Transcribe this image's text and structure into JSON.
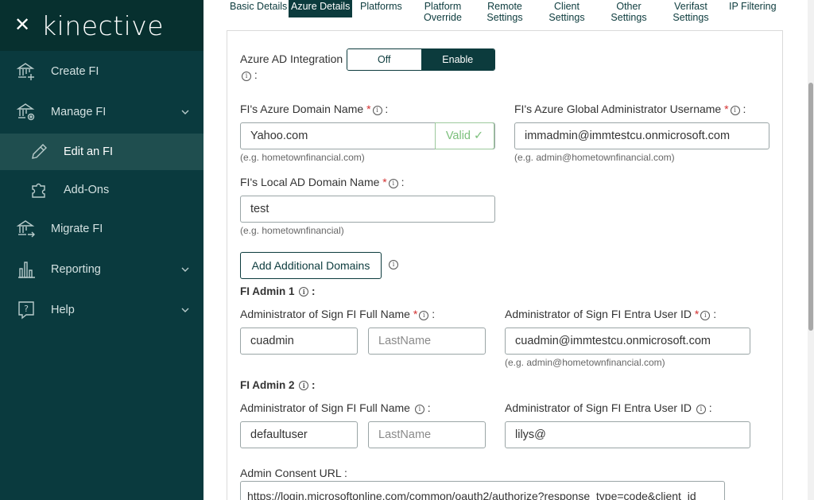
{
  "sidebar": {
    "brand": "kinective",
    "items": [
      {
        "label": "Create FI"
      },
      {
        "label": "Manage FI"
      },
      {
        "label": "Edit an FI"
      },
      {
        "label": "Add-Ons"
      },
      {
        "label": "Migrate FI"
      },
      {
        "label": "Reporting"
      },
      {
        "label": "Help"
      }
    ]
  },
  "tabs": [
    {
      "line1": "Basic Details",
      "line2": ""
    },
    {
      "line1": "Azure Details",
      "line2": ""
    },
    {
      "line1": "Platforms",
      "line2": ""
    },
    {
      "line1": "Platform",
      "line2": "Override"
    },
    {
      "line1": "Remote",
      "line2": "Settings"
    },
    {
      "line1": "Client",
      "line2": "Settings"
    },
    {
      "line1": "Other",
      "line2": "Settings"
    },
    {
      "line1": "Verifast",
      "line2": "Settings"
    },
    {
      "line1": "IP Filtering",
      "line2": ""
    }
  ],
  "azure": {
    "integration_label": "Azure AD Integration",
    "toggle_off": "Off",
    "toggle_on": "Enable",
    "domain_label": "FI's Azure Domain Name",
    "domain_value": "Yahoo.com",
    "domain_valid": "Valid ✓",
    "domain_hint": "(e.g. hometownfinancial.com)",
    "admin_label": "FI's Azure Global Administrator Username",
    "admin_value": "immadmin@immtestcu.onmicrosoft.com",
    "admin_hint": "(e.g. admin@hometownfinancial.com)",
    "local_label": "FI's Local AD Domain Name",
    "local_value": "test",
    "local_hint": "(e.g. hometownfinancial)",
    "add_domains": "Add Additional Domains"
  },
  "admin1": {
    "title": "FI Admin 1",
    "fullname_label": "Administrator of Sign FI Full Name",
    "first": "cuadmin",
    "last_placeholder": "LastName",
    "entra_label": "Administrator of Sign FI Entra User ID",
    "entra_value": "cuadmin@immtestcu.onmicrosoft.com",
    "entra_hint": "(e.g. admin@hometownfinancial.com)"
  },
  "admin2": {
    "title": "FI Admin 2",
    "fullname_label": "Administrator of Sign FI Full Name",
    "first": "defaultuser",
    "last_placeholder": "LastName",
    "entra_label": "Administrator of Sign FI Entra User ID",
    "entra_value": "lilys@"
  },
  "consent": {
    "label": "Admin Consent URL :",
    "value": "https://login.microsoftonline.com/common/oauth2/authorize?response_type=code&client_id"
  },
  "colors": {
    "sidebar": "#0a3a3e",
    "accent": "#0c3b3d",
    "valid": "#7bbf7b",
    "required": "#d32f2f"
  }
}
